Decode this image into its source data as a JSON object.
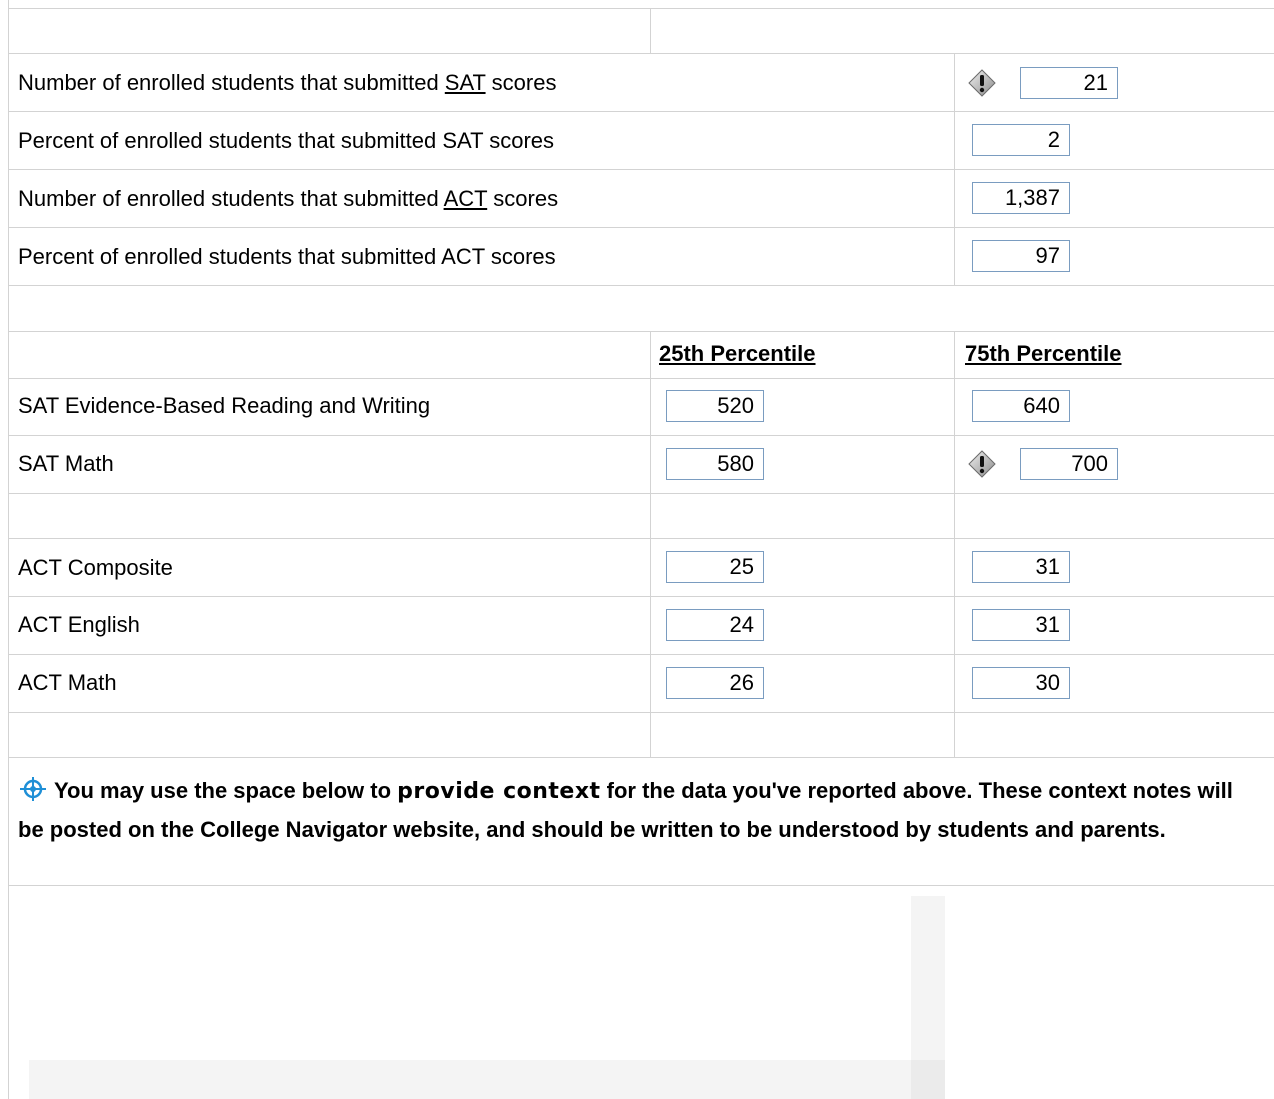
{
  "rows": {
    "sat_count": {
      "label_pre": "Number of enrolled students that submitted ",
      "label_link": "SAT",
      "label_post": " scores",
      "value": "21"
    },
    "sat_pct": {
      "label": "Percent of enrolled students that submitted SAT scores",
      "value": "2"
    },
    "act_count": {
      "label_pre": "Number of enrolled students that submitted ",
      "label_link": "ACT",
      "label_post": " scores",
      "value": "1,387"
    },
    "act_pct": {
      "label": "Percent of enrolled students that submitted ACT scores",
      "value": "97"
    }
  },
  "headers": {
    "p25": "25th Percentile",
    "p75": "75th Percentile"
  },
  "scores": {
    "sat_erw": {
      "label": "SAT Evidence-Based Reading and Writing",
      "p25": "520",
      "p75": "640"
    },
    "sat_math": {
      "label": "SAT Math",
      "p25": "580",
      "p75": "700"
    },
    "act_comp": {
      "label": "ACT Composite",
      "p25": "25",
      "p75": "31"
    },
    "act_eng": {
      "label": "ACT English",
      "p25": "24",
      "p75": "31"
    },
    "act_math": {
      "label": "ACT Math",
      "p25": "26",
      "p75": "30"
    }
  },
  "context_note": {
    "pre": "You may use the space below to ",
    "emph": "provide context",
    "post": " for the data you've reported above. These context notes will be posted on the College Navigator website, and should be written to be understood by students and parents."
  },
  "context_textarea": {
    "value": ""
  },
  "icons": {
    "warning": "warning-diamond-icon",
    "context": "crosshair-target-icon"
  }
}
